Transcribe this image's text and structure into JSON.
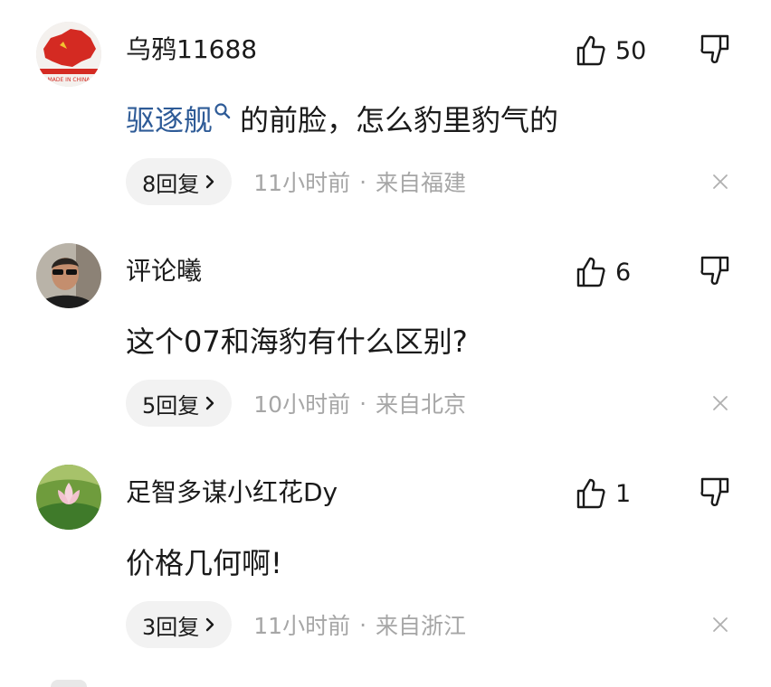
{
  "comments": [
    {
      "username": "乌鸦11688",
      "likes": "50",
      "content_link": "驱逐舰",
      "content_text": "的前脸，怎么豹里豹气的",
      "replies": "8回复",
      "time": "11小时前",
      "location": "来自福建",
      "avatar": "china-map-avatar"
    },
    {
      "username": "评论曦",
      "likes": "6",
      "content_link": "",
      "content_text": "这个07和海豹有什么区别?",
      "replies": "5回复",
      "time": "10小时前",
      "location": "来自北京",
      "avatar": "man-sunglasses-avatar"
    },
    {
      "username": "足智多谋小红花Dy",
      "likes": "1",
      "content_link": "",
      "content_text": "价格几何啊!",
      "replies": "3回复",
      "time": "11小时前",
      "location": "来自浙江",
      "avatar": "lotus-flower-avatar"
    }
  ],
  "separator": "·",
  "icons": {
    "like": "thumbs-up-icon",
    "dislike": "thumbs-down-icon",
    "close": "close-icon",
    "search": "search-icon",
    "chevron": "chevron-right-icon"
  },
  "colors": {
    "link": "#2e5b97",
    "meta": "#a6a6a6",
    "pill_bg": "#f2f2f2"
  }
}
